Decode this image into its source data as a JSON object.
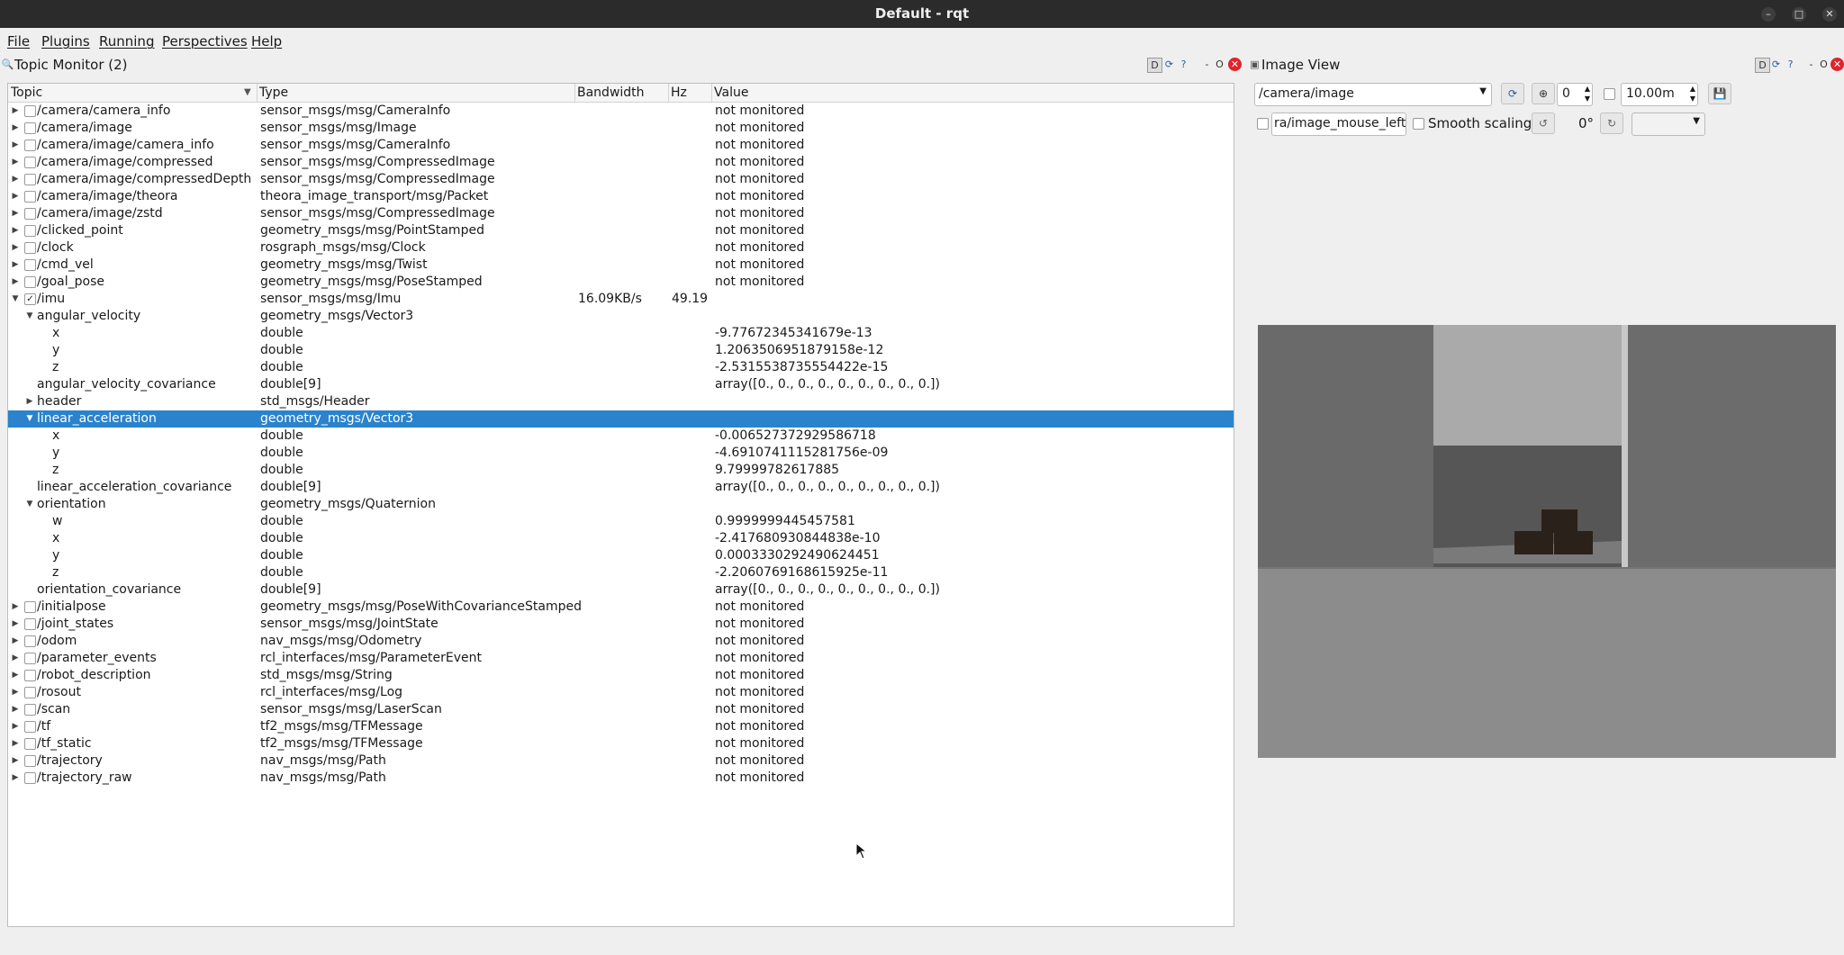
{
  "window": {
    "title": "Default - rqt",
    "controls": [
      "minimize-icon",
      "maximize-icon",
      "close-icon"
    ]
  },
  "menu": {
    "file": "File",
    "plugins": "Plugins",
    "running": "Running",
    "perspectives": "Perspectives",
    "help": "Help"
  },
  "topic_monitor": {
    "title": "Topic Monitor (2)",
    "columns": {
      "topic": "Topic",
      "type": "Type",
      "bandwidth": "Bandwidth",
      "hz": "Hz",
      "value": "Value"
    },
    "rows": [
      {
        "topic": "/camera/camera_info",
        "type": "sensor_msgs/msg/CameraInfo",
        "bandwidth": "",
        "hz": "",
        "value": "not monitored",
        "level": 0,
        "expand": "collapsed",
        "checkbox": "unchecked"
      },
      {
        "topic": "/camera/image",
        "type": "sensor_msgs/msg/Image",
        "bandwidth": "",
        "hz": "",
        "value": "not monitored",
        "level": 0,
        "expand": "collapsed",
        "checkbox": "unchecked"
      },
      {
        "topic": "/camera/image/camera_info",
        "type": "sensor_msgs/msg/CameraInfo",
        "bandwidth": "",
        "hz": "",
        "value": "not monitored",
        "level": 0,
        "expand": "collapsed",
        "checkbox": "unchecked"
      },
      {
        "topic": "/camera/image/compressed",
        "type": "sensor_msgs/msg/CompressedImage",
        "bandwidth": "",
        "hz": "",
        "value": "not monitored",
        "level": 0,
        "expand": "collapsed",
        "checkbox": "unchecked"
      },
      {
        "topic": "/camera/image/compressedDepth",
        "type": "sensor_msgs/msg/CompressedImage",
        "bandwidth": "",
        "hz": "",
        "value": "not monitored",
        "level": 0,
        "expand": "collapsed",
        "checkbox": "unchecked"
      },
      {
        "topic": "/camera/image/theora",
        "type": "theora_image_transport/msg/Packet",
        "bandwidth": "",
        "hz": "",
        "value": "not monitored",
        "level": 0,
        "expand": "collapsed",
        "checkbox": "unchecked"
      },
      {
        "topic": "/camera/image/zstd",
        "type": "sensor_msgs/msg/CompressedImage",
        "bandwidth": "",
        "hz": "",
        "value": "not monitored",
        "level": 0,
        "expand": "collapsed",
        "checkbox": "unchecked"
      },
      {
        "topic": "/clicked_point",
        "type": "geometry_msgs/msg/PointStamped",
        "bandwidth": "",
        "hz": "",
        "value": "not monitored",
        "level": 0,
        "expand": "collapsed",
        "checkbox": "unchecked"
      },
      {
        "topic": "/clock",
        "type": "rosgraph_msgs/msg/Clock",
        "bandwidth": "",
        "hz": "",
        "value": "not monitored",
        "level": 0,
        "expand": "collapsed",
        "checkbox": "unchecked"
      },
      {
        "topic": "/cmd_vel",
        "type": "geometry_msgs/msg/Twist",
        "bandwidth": "",
        "hz": "",
        "value": "not monitored",
        "level": 0,
        "expand": "collapsed",
        "checkbox": "unchecked"
      },
      {
        "topic": "/goal_pose",
        "type": "geometry_msgs/msg/PoseStamped",
        "bandwidth": "",
        "hz": "",
        "value": "not monitored",
        "level": 0,
        "expand": "collapsed",
        "checkbox": "unchecked"
      },
      {
        "topic": "/imu",
        "type": "sensor_msgs/msg/Imu",
        "bandwidth": "16.09KB/s",
        "hz": "49.19",
        "value": "",
        "level": 0,
        "expand": "expanded",
        "checkbox": "checked"
      },
      {
        "topic": "angular_velocity",
        "type": "geometry_msgs/Vector3",
        "bandwidth": "",
        "hz": "",
        "value": "",
        "level": 1,
        "expand": "expanded",
        "checkbox": "none"
      },
      {
        "topic": "x",
        "type": "double",
        "bandwidth": "",
        "hz": "",
        "value": "-9.77672345341679e-13",
        "level": 2,
        "expand": "none",
        "checkbox": "none"
      },
      {
        "topic": "y",
        "type": "double",
        "bandwidth": "",
        "hz": "",
        "value": "1.2063506951879158e-12",
        "level": 2,
        "expand": "none",
        "checkbox": "none"
      },
      {
        "topic": "z",
        "type": "double",
        "bandwidth": "",
        "hz": "",
        "value": "-2.5315538735554422e-15",
        "level": 2,
        "expand": "none",
        "checkbox": "none"
      },
      {
        "topic": "angular_velocity_covariance",
        "type": "double[9]",
        "bandwidth": "",
        "hz": "",
        "value": "array([0., 0., 0., 0., 0., 0., 0., 0., 0.])",
        "level": 1,
        "expand": "none",
        "checkbox": "none"
      },
      {
        "topic": "header",
        "type": "std_msgs/Header",
        "bandwidth": "",
        "hz": "",
        "value": "",
        "level": 1,
        "expand": "collapsed",
        "checkbox": "none"
      },
      {
        "topic": "linear_acceleration",
        "type": "geometry_msgs/Vector3",
        "bandwidth": "",
        "hz": "",
        "value": "",
        "level": 1,
        "expand": "expanded",
        "checkbox": "none",
        "selected": true
      },
      {
        "topic": "x",
        "type": "double",
        "bandwidth": "",
        "hz": "",
        "value": "-0.006527372929586718",
        "level": 2,
        "expand": "none",
        "checkbox": "none"
      },
      {
        "topic": "y",
        "type": "double",
        "bandwidth": "",
        "hz": "",
        "value": "-4.6910741115281756e-09",
        "level": 2,
        "expand": "none",
        "checkbox": "none"
      },
      {
        "topic": "z",
        "type": "double",
        "bandwidth": "",
        "hz": "",
        "value": "9.79999782617885",
        "level": 2,
        "expand": "none",
        "checkbox": "none"
      },
      {
        "topic": "linear_acceleration_covariance",
        "type": "double[9]",
        "bandwidth": "",
        "hz": "",
        "value": "array([0., 0., 0., 0., 0., 0., 0., 0., 0.])",
        "level": 1,
        "expand": "none",
        "checkbox": "none"
      },
      {
        "topic": "orientation",
        "type": "geometry_msgs/Quaternion",
        "bandwidth": "",
        "hz": "",
        "value": "",
        "level": 1,
        "expand": "expanded",
        "checkbox": "none"
      },
      {
        "topic": "w",
        "type": "double",
        "bandwidth": "",
        "hz": "",
        "value": "0.9999999445457581",
        "level": 2,
        "expand": "none",
        "checkbox": "none"
      },
      {
        "topic": "x",
        "type": "double",
        "bandwidth": "",
        "hz": "",
        "value": "-2.417680930844838e-10",
        "level": 2,
        "expand": "none",
        "checkbox": "none"
      },
      {
        "topic": "y",
        "type": "double",
        "bandwidth": "",
        "hz": "",
        "value": "0.0003330292490624451",
        "level": 2,
        "expand": "none",
        "checkbox": "none"
      },
      {
        "topic": "z",
        "type": "double",
        "bandwidth": "",
        "hz": "",
        "value": "-2.2060769168615925e-11",
        "level": 2,
        "expand": "none",
        "checkbox": "none"
      },
      {
        "topic": "orientation_covariance",
        "type": "double[9]",
        "bandwidth": "",
        "hz": "",
        "value": "array([0., 0., 0., 0., 0., 0., 0., 0., 0.])",
        "level": 1,
        "expand": "none",
        "checkbox": "none"
      },
      {
        "topic": "/initialpose",
        "type": "geometry_msgs/msg/PoseWithCovarianceStamped",
        "bandwidth": "",
        "hz": "",
        "value": "not monitored",
        "level": 0,
        "expand": "collapsed",
        "checkbox": "unchecked"
      },
      {
        "topic": "/joint_states",
        "type": "sensor_msgs/msg/JointState",
        "bandwidth": "",
        "hz": "",
        "value": "not monitored",
        "level": 0,
        "expand": "collapsed",
        "checkbox": "unchecked"
      },
      {
        "topic": "/odom",
        "type": "nav_msgs/msg/Odometry",
        "bandwidth": "",
        "hz": "",
        "value": "not monitored",
        "level": 0,
        "expand": "collapsed",
        "checkbox": "unchecked"
      },
      {
        "topic": "/parameter_events",
        "type": "rcl_interfaces/msg/ParameterEvent",
        "bandwidth": "",
        "hz": "",
        "value": "not monitored",
        "level": 0,
        "expand": "collapsed",
        "checkbox": "unchecked"
      },
      {
        "topic": "/robot_description",
        "type": "std_msgs/msg/String",
        "bandwidth": "",
        "hz": "",
        "value": "not monitored",
        "level": 0,
        "expand": "collapsed",
        "checkbox": "unchecked"
      },
      {
        "topic": "/rosout",
        "type": "rcl_interfaces/msg/Log",
        "bandwidth": "",
        "hz": "",
        "value": "not monitored",
        "level": 0,
        "expand": "collapsed",
        "checkbox": "unchecked"
      },
      {
        "topic": "/scan",
        "type": "sensor_msgs/msg/LaserScan",
        "bandwidth": "",
        "hz": "",
        "value": "not monitored",
        "level": 0,
        "expand": "collapsed",
        "checkbox": "unchecked"
      },
      {
        "topic": "/tf",
        "type": "tf2_msgs/msg/TFMessage",
        "bandwidth": "",
        "hz": "",
        "value": "not monitored",
        "level": 0,
        "expand": "collapsed",
        "checkbox": "unchecked"
      },
      {
        "topic": "/tf_static",
        "type": "tf2_msgs/msg/TFMessage",
        "bandwidth": "",
        "hz": "",
        "value": "not monitored",
        "level": 0,
        "expand": "collapsed",
        "checkbox": "unchecked"
      },
      {
        "topic": "/trajectory",
        "type": "nav_msgs/msg/Path",
        "bandwidth": "",
        "hz": "",
        "value": "not monitored",
        "level": 0,
        "expand": "collapsed",
        "checkbox": "unchecked"
      },
      {
        "topic": "/trajectory_raw",
        "type": "nav_msgs/msg/Path",
        "bandwidth": "",
        "hz": "",
        "value": "not monitored",
        "level": 0,
        "expand": "collapsed",
        "checkbox": "unchecked"
      }
    ]
  },
  "image_view": {
    "title": "Image View",
    "topic_select": "/camera/image",
    "spin_value": "0",
    "max_range": "10.00m",
    "mouse_topic": "ra/image_mouse_left",
    "smooth_scaling_label": "Smooth scaling",
    "rotation_label": "0°",
    "colors": {
      "selection": "#2a83cc",
      "close": "#e0242b"
    }
  }
}
